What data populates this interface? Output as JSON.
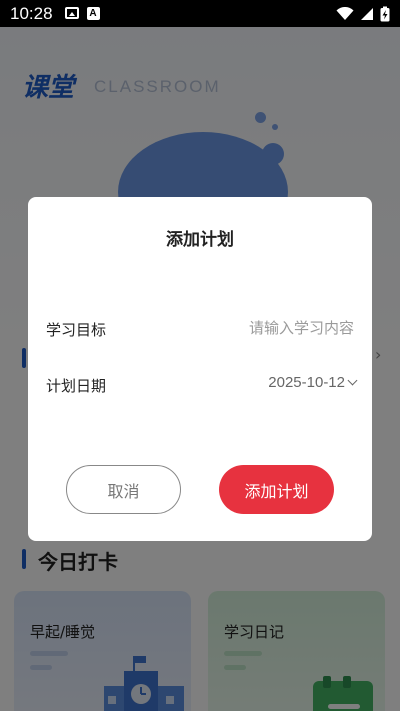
{
  "status_bar": {
    "time": "10:28",
    "left_icons": [
      "image-icon",
      "font-a-icon"
    ],
    "right_icons": [
      "wifi-icon",
      "signal-icon",
      "battery-charging-icon"
    ],
    "a_glyph": "A"
  },
  "background": {
    "hero_title": "课堂",
    "hero_subtitle": "CLASSROOM",
    "section_title": "今日打卡",
    "cards": [
      {
        "title": "早起/睡觉"
      },
      {
        "title": "学习日记"
      }
    ]
  },
  "dialog": {
    "title": "添加计划",
    "goal_label": "学习目标",
    "goal_placeholder": "请输入学习内容",
    "goal_value": "",
    "date_label": "计划日期",
    "date_value": "2025-10-12",
    "cancel_label": "取消",
    "confirm_label": "添加计划"
  },
  "colors": {
    "accent_blue": "#1f5cc9",
    "confirm_red": "#e7323f"
  }
}
